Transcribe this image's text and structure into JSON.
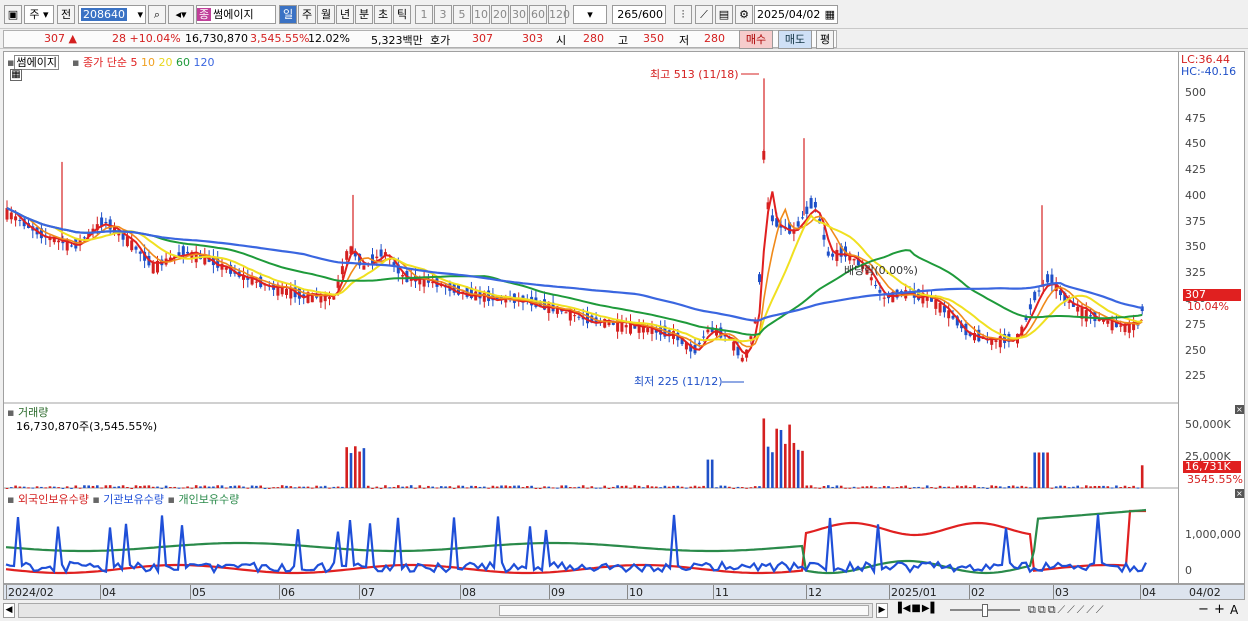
{
  "toolbar": {
    "market": "주",
    "prev": "전",
    "code": "208640",
    "stock_badge": "종",
    "stock_name": "썸에이지",
    "period_buttons": [
      "일",
      "주",
      "월",
      "년",
      "분",
      "초",
      "틱"
    ],
    "interval_buttons": [
      "1",
      "3",
      "5",
      "10",
      "20",
      "30",
      "60",
      "120"
    ],
    "count": "265",
    "count_total": "/600",
    "date": "2025/04/02"
  },
  "info": {
    "price": "307",
    "change": "28",
    "change_pct": "+10.04%",
    "volume": "16,730,870",
    "volume_pct": "3,545.55%",
    "turnover": "12.02%",
    "amount": "5,323백만",
    "hoga_label": "호가",
    "ask": "307",
    "bid": "303",
    "open_label": "시",
    "open": "280",
    "high_label": "고",
    "high": "350",
    "low_label": "저",
    "low": "280",
    "buy": "매수",
    "sell": "매도",
    "avg": "평"
  },
  "chart_data": [
    {
      "type": "line",
      "title": "썸에이지",
      "legend": {
        "label": "종가 단순",
        "periods": [
          "5",
          "10",
          "20",
          "60",
          "120"
        ]
      },
      "x_ticks": [
        "2024/02",
        "04",
        "05",
        "06",
        "07",
        "08",
        "09",
        "10",
        "11",
        "12",
        "2025/01",
        "02",
        "03",
        "04"
      ],
      "ylim": [
        205,
        525
      ],
      "y_ticks": [
        225,
        250,
        275,
        300,
        325,
        350,
        375,
        400,
        425,
        450,
        475,
        500
      ],
      "close_series_approx": [
        [
          "2024/02",
          385
        ],
        [
          "2024/03",
          355
        ],
        [
          "2024/04",
          375
        ],
        [
          "2024/05",
          330
        ],
        [
          "2024/06",
          305
        ],
        [
          "2024/07",
          350
        ],
        [
          "2024/08",
          305
        ],
        [
          "2024/09",
          290
        ],
        [
          "2024/10",
          270
        ],
        [
          "2024/11/12",
          238
        ],
        [
          "2024/11/18",
          460
        ],
        [
          "2024/12",
          350
        ],
        [
          "2025/01",
          300
        ],
        [
          "2025/02",
          265
        ],
        [
          "2025/03",
          300
        ],
        [
          "2025/04",
          307
        ]
      ],
      "annotations": {
        "high": "최고 513 (11/18)",
        "low": "최저 225 (11/12)",
        "dividend": "배당락(0.00%)"
      },
      "right_labels": {
        "lc": "LC:36.44",
        "hc": "HC:-40.16",
        "last": "307",
        "last_pct": "10.04%"
      }
    },
    {
      "type": "bar",
      "title": "거래량",
      "current": "16,730,870주(3,545.55%)",
      "y_ticks": [
        "50,000K",
        "25,000K"
      ],
      "last": "16,731K",
      "last_pct": "3545.55%"
    },
    {
      "type": "line",
      "legend": [
        "외국인보유수량",
        "기관보유수량",
        "개인보유수량"
      ],
      "y_ticks": [
        "1,000,000",
        "0"
      ]
    }
  ],
  "bottom": {
    "right_date": "04/02",
    "zoom_minus": "−",
    "zoom_plus": "+",
    "a": "A"
  },
  "colors": {
    "red": "#e02020",
    "blue": "#1f4fd8",
    "up": "#d42020",
    "down": "#1f50c8",
    "ma5": "#e02020",
    "ma10": "#f08a1a",
    "ma20": "#f0e020",
    "ma60": "#1e9a3a",
    "ma120": "#3a66e0"
  }
}
